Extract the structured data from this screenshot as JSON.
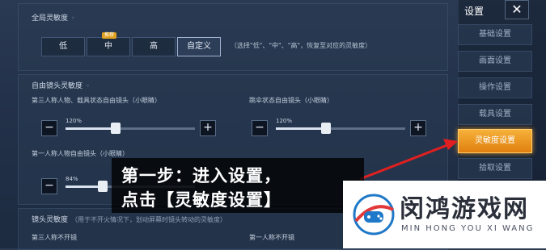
{
  "global": {
    "title": "全局灵敏度",
    "options": [
      "低",
      "中",
      "高",
      "自定义"
    ],
    "selected": "自定义",
    "recommended_badge": "推荐",
    "hint": "（选择\"低\"、\"中\"、\"高\"，恢复至对应的灵敏度）"
  },
  "free_look": {
    "title": "自由镜头灵敏度",
    "third_person": {
      "label": "第三人称人物、载具状态自由镜头（小眼睛）",
      "value_label": "120%",
      "value": 120
    },
    "parachute": {
      "label": "跳伞状态自由镜头（小眼睛）",
      "value_label": "120%",
      "value": 120
    },
    "first_person": {
      "label": "第一人称人物自由镜头（小眼睛）",
      "value_label": "84%",
      "value": 84
    }
  },
  "lens": {
    "title": "镜头灵敏度",
    "note": "（用于不开火情况下，划动屏幕时镜头转动的灵敏度）",
    "third_person_no_scope": "第三人称不开镜",
    "first_person_no_scope": "第一人称不开镜"
  },
  "sidebar": {
    "header": "设置",
    "close": "✕",
    "items": [
      {
        "label": "基础设置",
        "active": false
      },
      {
        "label": "画面设置",
        "active": false
      },
      {
        "label": "操作设置",
        "active": false
      },
      {
        "label": "载具设置",
        "active": false
      },
      {
        "label": "灵敏度设置",
        "active": true
      },
      {
        "label": "拾取设置",
        "active": false
      }
    ]
  },
  "overlay": {
    "line1": "第一步：进入设置，",
    "line2": "点击【灵敏度设置】"
  },
  "watermark": {
    "cn": "闵鸿游戏网",
    "en": "MIN HONG YOU XI WANG"
  },
  "colors": {
    "active_tab": "#f0a02a",
    "arrow": "#e02020"
  }
}
